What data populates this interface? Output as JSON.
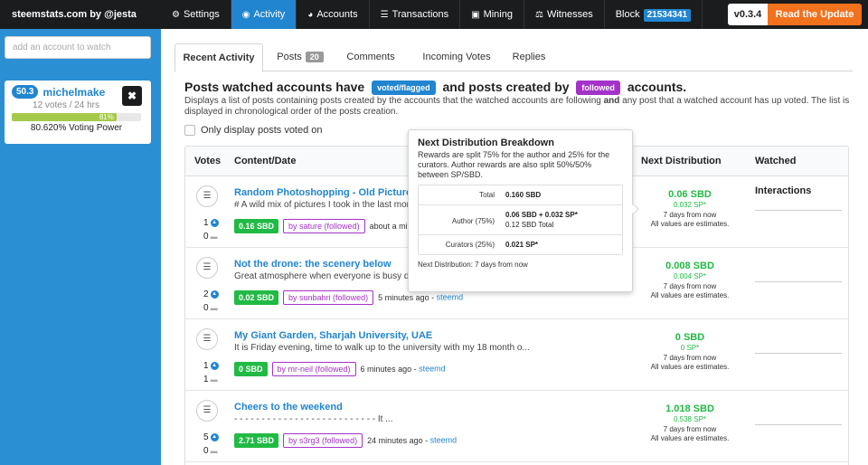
{
  "sidebar": {
    "brand": "steemstats.com by @jesta",
    "add_placeholder": "add an account to watch",
    "account": {
      "reputation": "50.3",
      "name": "michelmake",
      "votes": "12 votes / 24 hrs",
      "voting_percent": "81%",
      "voting_fill": 0.81,
      "voting_power": "80.620% Voting Power"
    }
  },
  "nav": {
    "items": [
      {
        "icon": "gear-icon",
        "glyph": "⚙",
        "label": "Settings"
      },
      {
        "icon": "rss-icon",
        "glyph": "◉",
        "label": "Activity"
      },
      {
        "icon": "pie-icon",
        "glyph": "◕",
        "label": "Accounts"
      },
      {
        "icon": "list-icon",
        "glyph": "☰",
        "label": "Transactions"
      },
      {
        "icon": "cube-icon",
        "glyph": "▣",
        "label": "Mining"
      },
      {
        "icon": "scale-icon",
        "glyph": "⚖",
        "label": "Witnesses"
      }
    ],
    "block_label": "Block",
    "block_number": "21534341",
    "version": "v0.3.4",
    "update": "Read the Update"
  },
  "tabs": [
    {
      "label": "Recent Activity"
    },
    {
      "label": "Posts",
      "count": "20"
    },
    {
      "label": "Comments"
    },
    {
      "label": "Incoming Votes"
    },
    {
      "label": "Replies"
    }
  ],
  "section": {
    "title_a": "Posts watched accounts have",
    "tag_voted": "voted/flagged",
    "title_b": "and posts created by",
    "tag_followed": "followed",
    "title_c": "accounts.",
    "description_a": "Displays a list of posts containing posts created by the accounts that the watched accounts are following ",
    "description_and": "and",
    "description_b": " any post that a watched account has up voted. The list is displayed in chronological order of the posts creation.",
    "checkbox_label": "Only display posts voted on"
  },
  "table": {
    "headers": {
      "votes": "Votes",
      "content": "Content/Date",
      "distribution": "Next Distribution",
      "watched": "Watched Interactions"
    },
    "rows": [
      {
        "title": "Random Photoshopping - Old Pictures Fu",
        "snippet": "# A wild mix of pictures I took in the last mon",
        "votes": "1",
        "comments": "0",
        "sbd": "0.16 SBD",
        "by": "by sature (followed)",
        "ago": "about a minute a",
        "voter": "",
        "dist_sbd": "0.06 SBD",
        "dist_sp": "0.032 SP*",
        "dist_days": "7 days from now",
        "dist_est": "All values are estimates."
      },
      {
        "title": "Not the drone: the scenery below",
        "snippet": "Great atmosphere when everyone is busy do",
        "votes": "2",
        "comments": "0",
        "sbd": "0.02 SBD",
        "by": "by sunbahri (followed)",
        "ago": "5 minutes ago - ",
        "voter": "steemd",
        "dist_sbd": "0.008 SBD",
        "dist_sp": "0.004 SP*",
        "dist_days": "7 days from now",
        "dist_est": "All values are estimates."
      },
      {
        "title": "My Giant Garden, Sharjah University, UAE",
        "snippet": "It is Friday evening, time to walk up to the university with my 18 month o...",
        "votes": "1",
        "comments": "1",
        "sbd": "0 SBD",
        "by": "by mr-neil (followed)",
        "ago": "6 minutes ago - ",
        "voter": "steemd",
        "dist_sbd": "0 SBD",
        "dist_sp": "0 SP*",
        "dist_days": "7 days from now",
        "dist_est": "All values are estimates."
      },
      {
        "title": "Cheers to the weekend",
        "snippet": "- - - - - - - - - - - - - - - - - - - - - - - - - - It ...",
        "votes": "5",
        "comments": "0",
        "sbd": "2.71 SBD",
        "by": "by s3rg3 (followed)",
        "ago": "24 minutes ago - ",
        "voter": "steemd",
        "dist_sbd": "1.018 SBD",
        "dist_sp": "0.538 SP*",
        "dist_days": "7 days from now",
        "dist_est": "All values are estimates."
      }
    ]
  },
  "popup": {
    "title": "Next Distribution Breakdown",
    "description": "Rewards are split 75% for the author and 25% for the curators. Author rewards are also split 50%/50% between SP/SBD.",
    "total_label": "Total",
    "total_value": "0.160 SBD",
    "author_label": "Author (75%)",
    "author_value": "0.06 SBD + 0.032 SP*",
    "author_total": "0.12 SBD Total",
    "curators_label": "Curators (25%)",
    "curators_value": "0.021 SP*",
    "next": "Next Distribution: 7 days from now"
  },
  "colors": {
    "accent": "#2185d0",
    "green": "#21ba45",
    "purple": "#a333c8",
    "orange": "#f2711c"
  }
}
